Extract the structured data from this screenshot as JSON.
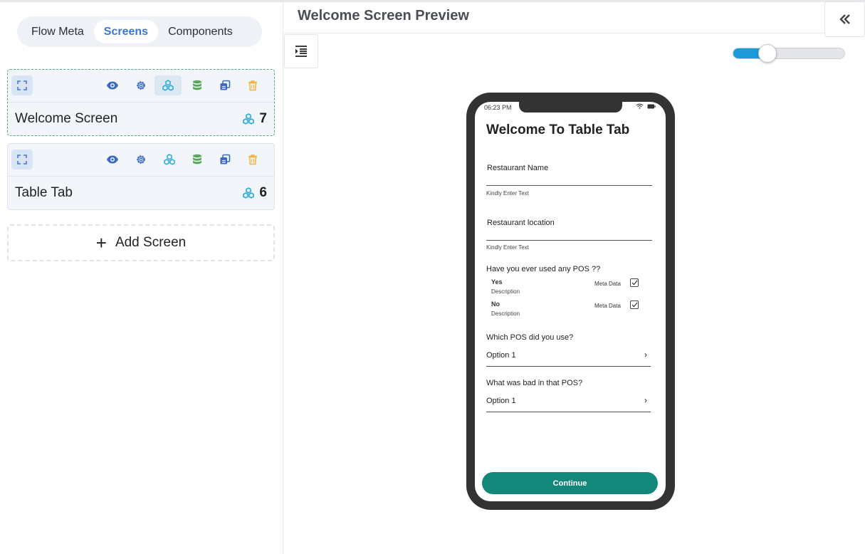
{
  "left_panel": {
    "tabs": [
      {
        "label": "Flow Meta"
      },
      {
        "label": "Screens"
      },
      {
        "label": "Components"
      }
    ],
    "active_tab": "Screens",
    "screens": [
      {
        "name": "Welcome Screen",
        "count": "7",
        "selected": true
      },
      {
        "name": "Table Tab",
        "count": "6",
        "selected": false
      }
    ],
    "add_screen_label": "Add Screen"
  },
  "preview": {
    "title": "Welcome Screen Preview",
    "zoom_fraction": 0.31
  },
  "phone": {
    "time": "06:23 PM",
    "title": "Welcome To Table Tab",
    "fields": [
      {
        "label": "Restaurant Name",
        "hint": "Kindly Enter Text"
      },
      {
        "label": "Restaurant location",
        "hint": "Kindly Enter Text"
      }
    ],
    "question": "Have you ever used any POS ??",
    "options": [
      {
        "title": "Yes",
        "desc": "Description",
        "meta": "Meta Data",
        "checked": true
      },
      {
        "title": "No",
        "desc": "Description",
        "meta": "Meta Data",
        "checked": true
      }
    ],
    "selects": [
      {
        "label": "Which POS did you use?",
        "value": "Option 1"
      },
      {
        "label": "What was bad in that POS?",
        "value": "Option 1"
      }
    ],
    "continue_label": "Continue"
  },
  "colors": {
    "accent_blue": "#3a76d6",
    "slider_blue": "#1e9ad8",
    "continue_green": "#13887a",
    "selected_border": "#4caf72",
    "cyan_icon": "#29a8d6",
    "green_icon": "#5aa65d",
    "trash_icon": "#f3b23a"
  },
  "icons": {
    "card_tools": [
      "expand-icon",
      "eye-icon",
      "gear-icon",
      "components-icon",
      "database-icon",
      "duplicate-icon",
      "trash-icon"
    ],
    "collapse": "double-chevron-left-icon",
    "indent": "indent-icon"
  }
}
